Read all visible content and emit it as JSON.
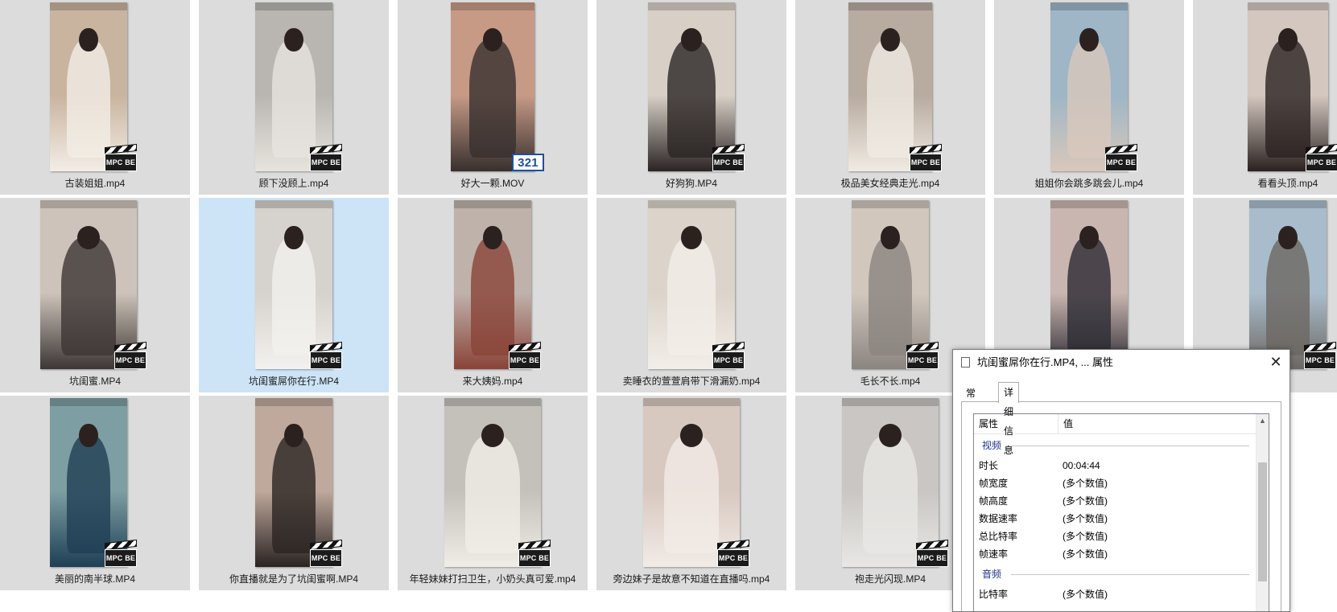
{
  "files": [
    {
      "name": "古装姐姐.mp4",
      "badge": "MPC BE",
      "bg": "#c9b49f",
      "accent": "#f3ede6"
    },
    {
      "name": "顾下没顾上.mp4",
      "badge": "MPC BE",
      "bg": "#b9b6b1",
      "accent": "#e7e4de"
    },
    {
      "name": "好大一颗.MOV",
      "badge": "321",
      "bg": "#c79a86",
      "accent": "#37302e"
    },
    {
      "name": "好狗狗.MP4",
      "badge": "MPC BE",
      "bg": "#d8cfc6",
      "accent": "#2a2424"
    },
    {
      "name": "极品美女经典走光.mp4",
      "badge": "MPC BE",
      "bg": "#b8aba0",
      "accent": "#f0ebe3"
    },
    {
      "name": "姐姐你会跳多跳会儿.mp4",
      "badge": "MPC BE",
      "bg": "#9eb6c6",
      "accent": "#d9c8bb"
    },
    {
      "name": "看看头顶.mp4",
      "badge": "MPC BE",
      "bg": "#d4c7c0",
      "accent": "#2a2220"
    },
    {
      "name": "坑闺蜜.MP4",
      "badge": "MPC BE",
      "bg": "#cdc3ba",
      "accent": "#3d3634"
    },
    {
      "name": "坑闺蜜屌你在行.MP4",
      "badge": "MPC BE",
      "bg": "#d6d2cd",
      "accent": "#f3f1ee"
    },
    {
      "name": "来大姨妈.mp4",
      "badge": "MPC BE",
      "bg": "#bfb2ab",
      "accent": "#8a4338"
    },
    {
      "name": "卖睡衣的萱萱肩带下滑漏奶.mp4",
      "badge": "MPC BE",
      "bg": "#dcd4cb",
      "accent": "#f2eee8"
    },
    {
      "name": "毛长不长.mp4",
      "badge": "MPC BE",
      "bg": "#d1c7bd",
      "accent": "#8b8580"
    },
    {
      "name": "",
      "badge": "",
      "bg": "#cab6b0",
      "accent": "#2c2a33"
    },
    {
      "name": "",
      "badge": "MPC BE",
      "bg": "#a9bccb",
      "accent": "#6c6762"
    },
    {
      "name": "美丽的南半球.MP4",
      "badge": "MPC BE",
      "bg": "#7d9ea2",
      "accent": "#1f3f55"
    },
    {
      "name": "你直播就是为了坑闺蜜啊.MP4",
      "badge": "MPC BE",
      "bg": "#bfa89c",
      "accent": "#2a2422"
    },
    {
      "name": "年轻妹妹打扫卫生，小奶头真可爱.mp4",
      "badge": "MPC BE",
      "bg": "#c4c1bb",
      "accent": "#f0ede7"
    },
    {
      "name": "旁边妹子是故意不知道在直播吗.mp4",
      "badge": "MPC BE",
      "bg": "#d8c9c0",
      "accent": "#f2ebe6"
    },
    {
      "name": "袍走光闪现.MP4",
      "badge": "MPC BE",
      "bg": "#c9c6c3",
      "accent": "#e9e7e5"
    }
  ],
  "dialog": {
    "title": "坑闺蜜屌你在行.MP4, ... 属性",
    "close": "✕",
    "tabs": [
      "常规",
      "详细信息"
    ],
    "header": {
      "property": "属性",
      "value": "值"
    },
    "groups": [
      {
        "label": "视频",
        "rows": [
          {
            "k": "时长",
            "v": "00:04:44"
          },
          {
            "k": "帧宽度",
            "v": "(多个数值)"
          },
          {
            "k": "帧高度",
            "v": "(多个数值)"
          },
          {
            "k": "数据速率",
            "v": "(多个数值)"
          },
          {
            "k": "总比特率",
            "v": "(多个数值)"
          },
          {
            "k": "帧速率",
            "v": "(多个数值)"
          }
        ]
      },
      {
        "label": "音频",
        "rows": [
          {
            "k": "比特率",
            "v": "(多个数值)"
          }
        ]
      }
    ]
  }
}
